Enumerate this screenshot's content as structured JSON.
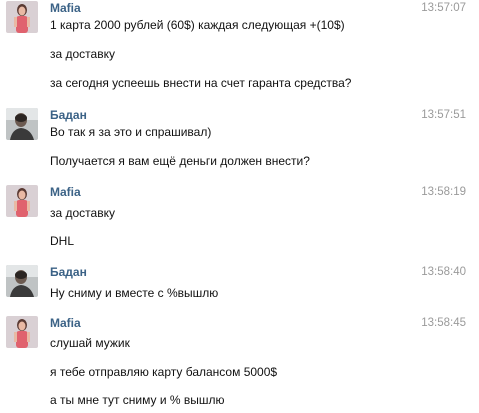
{
  "messages": [
    {
      "author": "Mafia",
      "time": "13:57:07",
      "avatar": "girl-photo",
      "lines": [
        "1 карта 2000 рублей (60$) каждая следующая +(10$)",
        "за доставку",
        "за сегодня успеешь внести на счет гаранта средства?"
      ]
    },
    {
      "author": "Бадан",
      "time": "13:57:51",
      "avatar": "man-photo",
      "lines": [
        "Во так я за это и спрашивал)",
        "Получается я вам ещё деньги должен внести?"
      ]
    },
    {
      "author": "Mafia",
      "time": "13:58:19",
      "avatar": "girl-photo",
      "lines": [
        "за доставку",
        "DHL"
      ]
    },
    {
      "author": "Бадан",
      "time": "13:58:40",
      "avatar": "man-photo",
      "lines": [
        "Ну сниму и вместе с %вышлю"
      ]
    },
    {
      "author": "Mafia",
      "time": "13:58:45",
      "avatar": "girl-photo",
      "lines": [
        "слушай мужик",
        "я тебе отправляю карту балансом 5000$",
        "а ты мне тут сниму и % вышлю"
      ]
    }
  ],
  "colors": {
    "author": "#3b6286",
    "time": "#9a9a9a",
    "text": "#111111",
    "background": "#ffffff"
  }
}
